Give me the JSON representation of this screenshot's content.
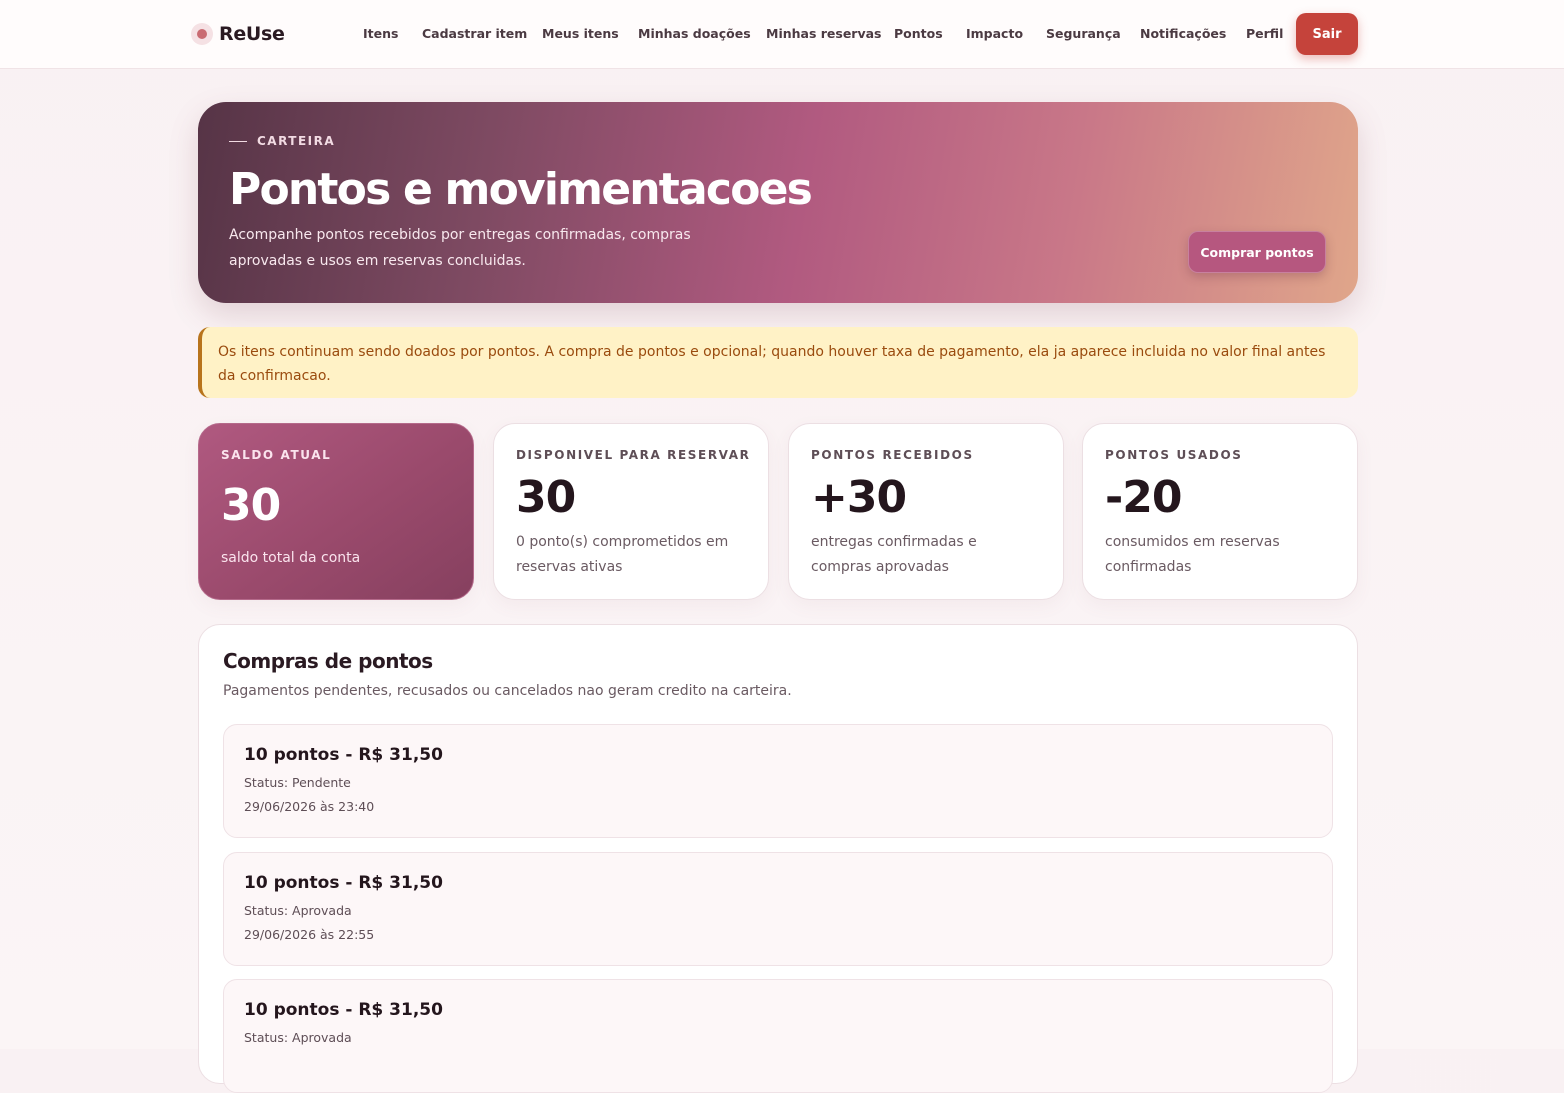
{
  "brand": {
    "name": "ReUse",
    "icon": "dot-logo"
  },
  "nav": {
    "items": [
      "Itens",
      "Cadastrar item",
      "Meus itens",
      "Minhas doações",
      "Minhas reservas",
      "Pontos",
      "Impacto",
      "Segurança",
      "Notificações",
      "Perfil"
    ],
    "logout": "Sair"
  },
  "hero": {
    "eyebrow": "CARTEIRA",
    "title": "Pontos e movimentacoes",
    "description": "Acompanhe pontos recebidos por entregas confirmadas, compras aprovadas e usos em reservas concluidas.",
    "button": "Comprar pontos"
  },
  "notice": {
    "text": "Os itens continuam sendo doados por pontos. A compra de pontos e opcional; quando houver taxa de pagamento, ela ja aparece incluida no valor final antes da confirmacao."
  },
  "stats": [
    {
      "label": "SALDO ATUAL",
      "value": "30",
      "desc": "saldo total da conta"
    },
    {
      "label": "DISPONIVEL PARA RESERVAR",
      "value": "30",
      "desc": "0 ponto(s) comprometidos em reservas ativas"
    },
    {
      "label": "PONTOS RECEBIDOS",
      "value": "+30",
      "desc": "entregas confirmadas e compras aprovadas"
    },
    {
      "label": "PONTOS USADOS",
      "value": "-20",
      "desc": "consumidos em reservas confirmadas"
    }
  ],
  "purchases": {
    "title": "Compras de pontos",
    "subtitle": "Pagamentos pendentes, recusados ou cancelados nao geram credito na carteira.",
    "items": [
      {
        "title": "10 pontos - R$ 31,50",
        "status": "Status: Pendente",
        "date": "29/06/2026 às 23:40"
      },
      {
        "title": "10 pontos - R$ 31,50",
        "status": "Status: Aprovada",
        "date": "29/06/2026 às 22:55"
      },
      {
        "title": "10 pontos - R$ 31,50",
        "status": "Status: Aprovada",
        "date": ""
      }
    ]
  },
  "colors": {
    "accent": "#b05980",
    "logout": "#c5433b",
    "notice_bg": "#fff2c6",
    "notice_text": "#9a4b0e"
  }
}
